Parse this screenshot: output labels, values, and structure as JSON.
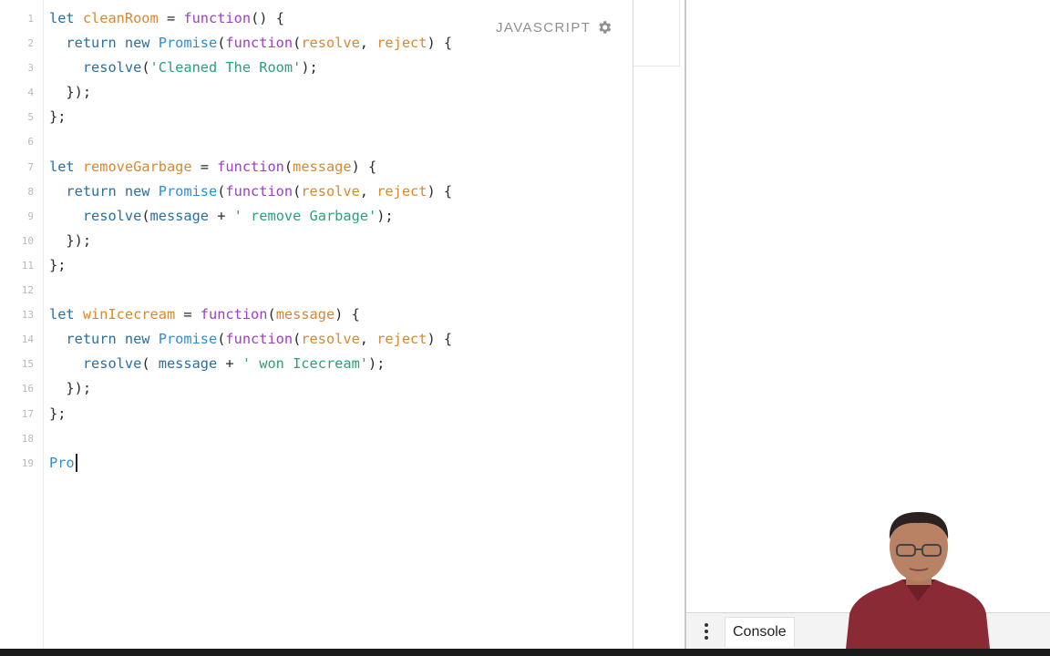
{
  "editor": {
    "language_label": "JAVASCRIPT",
    "line_numbers": [
      "1",
      "2",
      "3",
      "4",
      "5",
      "6",
      "7",
      "8",
      "9",
      "10",
      "11",
      "12",
      "13",
      "14",
      "15",
      "16",
      "17",
      "18",
      "19"
    ],
    "lines": [
      [
        {
          "t": "let ",
          "c": "kw"
        },
        {
          "t": "cleanRoom",
          "c": "var"
        },
        {
          "t": " = "
        },
        {
          "t": "function",
          "c": "purple"
        },
        {
          "t": "() {"
        }
      ],
      [
        {
          "t": "  return ",
          "c": "kw"
        },
        {
          "t": "new ",
          "c": "kw"
        },
        {
          "t": "Promise",
          "c": "fn"
        },
        {
          "t": "("
        },
        {
          "t": "function",
          "c": "purple"
        },
        {
          "t": "("
        },
        {
          "t": "resolve",
          "c": "par"
        },
        {
          "t": ", "
        },
        {
          "t": "reject",
          "c": "par"
        },
        {
          "t": ") {"
        }
      ],
      [
        {
          "t": "    "
        },
        {
          "t": "resolve",
          "c": "kw"
        },
        {
          "t": "("
        },
        {
          "t": "'Cleaned The Room'",
          "c": "str"
        },
        {
          "t": ");"
        }
      ],
      [
        {
          "t": "  });"
        }
      ],
      [
        {
          "t": "};"
        }
      ],
      [
        {
          "t": ""
        }
      ],
      [
        {
          "t": "let ",
          "c": "kw"
        },
        {
          "t": "removeGarbage",
          "c": "var"
        },
        {
          "t": " = "
        },
        {
          "t": "function",
          "c": "purple"
        },
        {
          "t": "("
        },
        {
          "t": "message",
          "c": "par"
        },
        {
          "t": ") {"
        }
      ],
      [
        {
          "t": "  return ",
          "c": "kw"
        },
        {
          "t": "new ",
          "c": "kw"
        },
        {
          "t": "Promise",
          "c": "fn"
        },
        {
          "t": "("
        },
        {
          "t": "function",
          "c": "purple"
        },
        {
          "t": "("
        },
        {
          "t": "resolve",
          "c": "par"
        },
        {
          "t": ", "
        },
        {
          "t": "reject",
          "c": "par"
        },
        {
          "t": ") {"
        }
      ],
      [
        {
          "t": "    "
        },
        {
          "t": "resolve",
          "c": "kw"
        },
        {
          "t": "("
        },
        {
          "t": "message",
          "c": "kw"
        },
        {
          "t": " + "
        },
        {
          "t": "' remove Garbage'",
          "c": "str"
        },
        {
          "t": ");"
        }
      ],
      [
        {
          "t": "  });"
        }
      ],
      [
        {
          "t": "};"
        }
      ],
      [
        {
          "t": ""
        }
      ],
      [
        {
          "t": "let ",
          "c": "kw"
        },
        {
          "t": "winIcecream",
          "c": "var"
        },
        {
          "t": " = "
        },
        {
          "t": "function",
          "c": "purple"
        },
        {
          "t": "("
        },
        {
          "t": "message",
          "c": "par"
        },
        {
          "t": ") {"
        }
      ],
      [
        {
          "t": "  return ",
          "c": "kw"
        },
        {
          "t": "new ",
          "c": "kw"
        },
        {
          "t": "Promise",
          "c": "fn"
        },
        {
          "t": "("
        },
        {
          "t": "function",
          "c": "purple"
        },
        {
          "t": "("
        },
        {
          "t": "resolve",
          "c": "par"
        },
        {
          "t": ", "
        },
        {
          "t": "reject",
          "c": "par"
        },
        {
          "t": ") {"
        }
      ],
      [
        {
          "t": "    "
        },
        {
          "t": "resolve",
          "c": "kw"
        },
        {
          "t": "( "
        },
        {
          "t": "message",
          "c": "kw"
        },
        {
          "t": " + "
        },
        {
          "t": "' won Icecream'",
          "c": "str"
        },
        {
          "t": ");"
        }
      ],
      [
        {
          "t": "  });"
        }
      ],
      [
        {
          "t": "};"
        }
      ],
      [
        {
          "t": ""
        }
      ],
      [
        {
          "t": "Pro",
          "c": "fn"
        }
      ]
    ],
    "cursor_line": 19
  },
  "console": {
    "tab_label": "Console",
    "menu_icon": "vertical-dots-icon"
  },
  "colors": {
    "keyword": "#2a6f9f",
    "function_name": "#2f8dd1",
    "variable": "#d8882f",
    "string": "#2aa07c",
    "function_keyword": "#9c40c4"
  }
}
